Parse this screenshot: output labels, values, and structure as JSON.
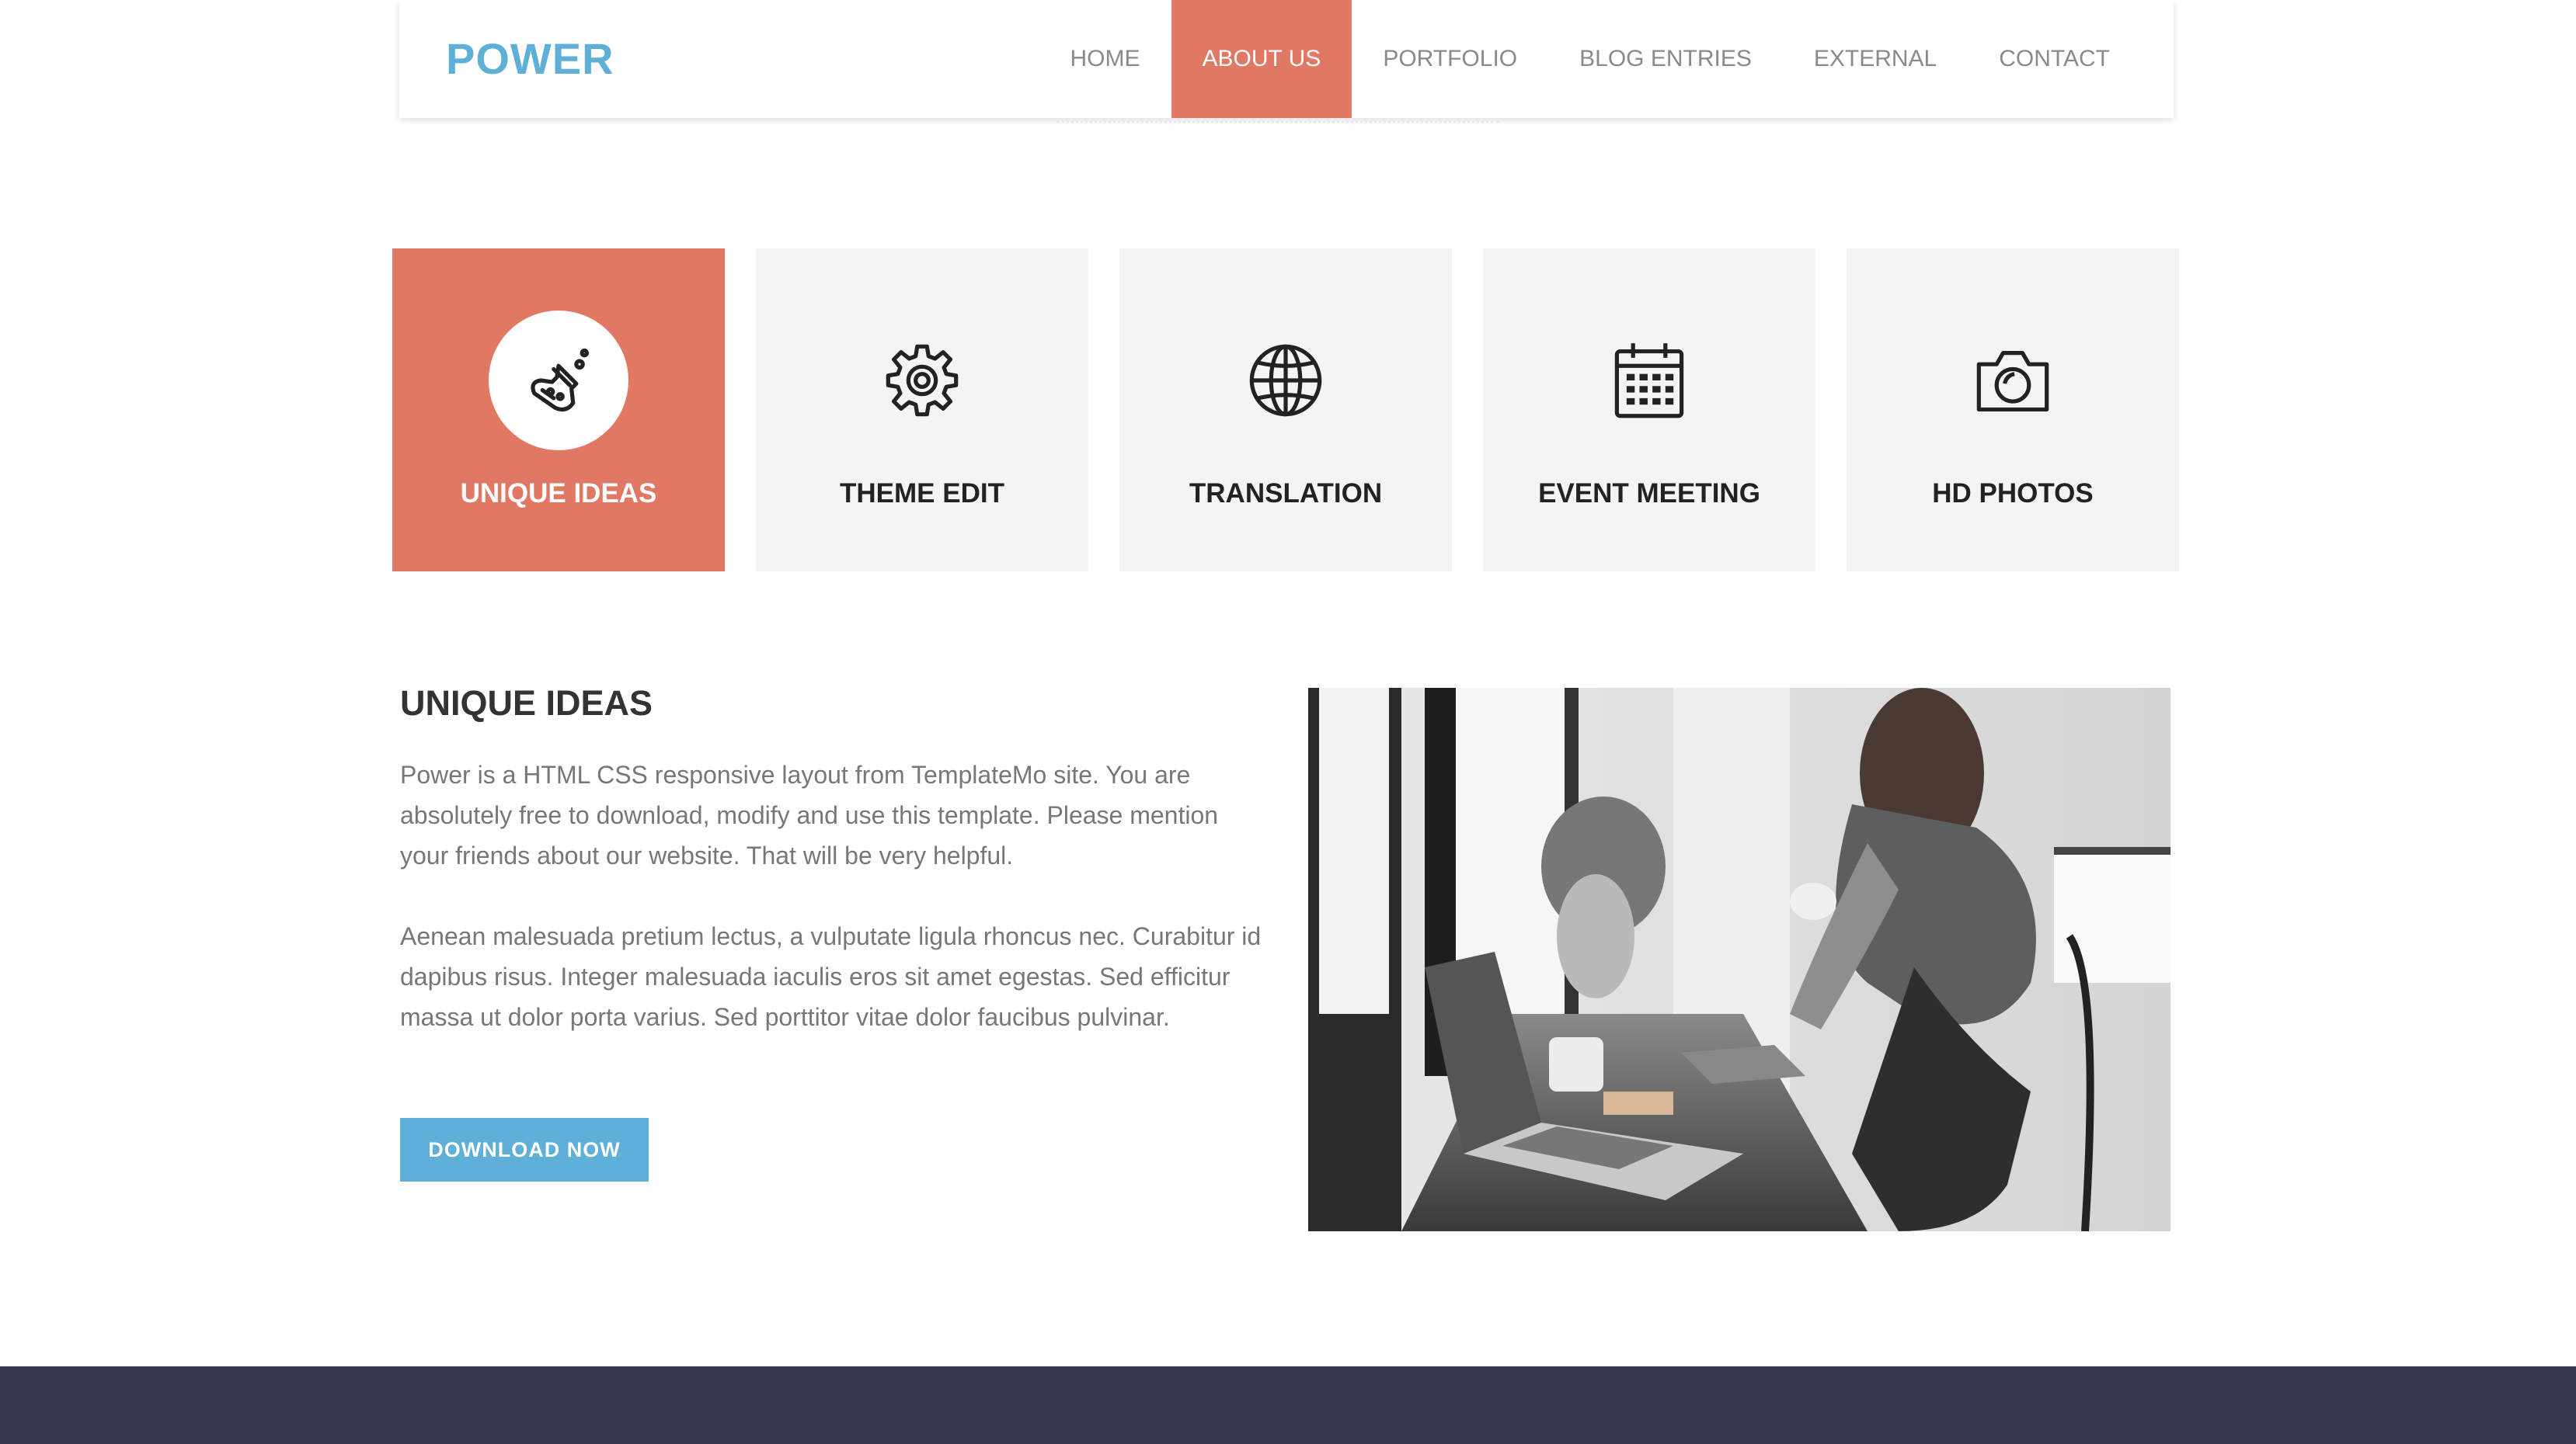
{
  "brand": "POWER",
  "nav": [
    {
      "label": "HOME",
      "active": false
    },
    {
      "label": "ABOUT US",
      "active": true
    },
    {
      "label": "PORTFOLIO",
      "active": false
    },
    {
      "label": "BLOG ENTRIES",
      "active": false
    },
    {
      "label": "EXTERNAL",
      "active": false
    },
    {
      "label": "CONTACT",
      "active": false
    }
  ],
  "features": [
    {
      "label": "UNIQUE IDEAS",
      "icon": "flask-icon",
      "active": true
    },
    {
      "label": "THEME EDIT",
      "icon": "gear-icon",
      "active": false
    },
    {
      "label": "TRANSLATION",
      "icon": "globe-icon",
      "active": false
    },
    {
      "label": "EVENT MEETING",
      "icon": "calendar-icon",
      "active": false
    },
    {
      "label": "HD PHOTOS",
      "icon": "camera-icon",
      "active": false
    }
  ],
  "content": {
    "title": "UNIQUE IDEAS",
    "paragraph1": "Power is a HTML CSS responsive layout from TemplateMo site. You are absolutely free to download, modify and use this template. Please mention your friends about our website. That will be very helpful.",
    "paragraph2": "Aenean malesuada pretium lectus, a vulputate ligula rhoncus nec. Curabitur id dapibus risus. Integer malesuada iaculis eros sit amet egestas. Sed efficitur massa ut dolor porta varius. Sed porttitor vitae dolor faucibus pulvinar.",
    "button": "DOWNLOAD NOW"
  },
  "colors": {
    "accent": "#e07864",
    "brand": "#5fb0d9",
    "footer": "#373a4f",
    "box": "#f4f4f4"
  }
}
